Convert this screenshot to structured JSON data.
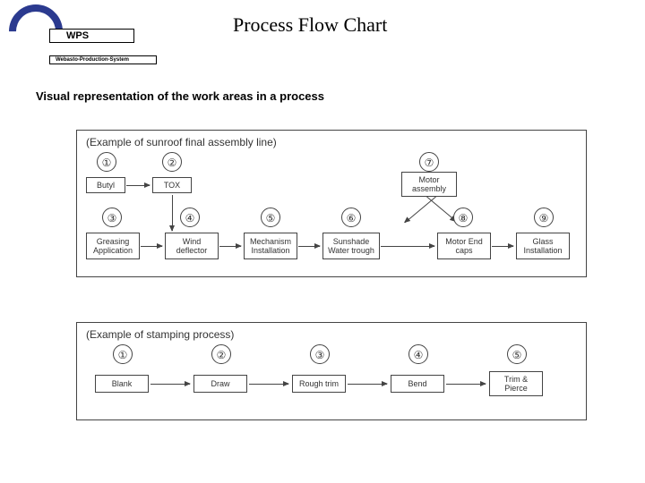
{
  "logo": {
    "abbr": "WPS",
    "full": "Webasto-Production-System"
  },
  "title": "Process Flow Chart",
  "subtitle": "Visual representation of the work areas in a process",
  "diagram1": {
    "caption": "(Example of sunroof final assembly line)",
    "steps": {
      "n1": "①",
      "n2": "②",
      "n3": "③",
      "n4": "④",
      "n5": "⑤",
      "n6": "⑥",
      "n7": "⑦",
      "n8": "⑧",
      "n9": "⑨"
    },
    "boxes": {
      "butyl": "Butyl",
      "tox": "TOX",
      "motor_assembly": "Motor assembly",
      "greasing": "Greasing Application",
      "wind": "Wind deflector",
      "mechanism": "Mechanism Installation",
      "sunshade": "Sunshade Water trough",
      "motor_endcaps": "Motor End caps",
      "glass": "Glass Installation"
    }
  },
  "diagram2": {
    "caption": "(Example of stamping process)",
    "steps": {
      "n1": "①",
      "n2": "②",
      "n3": "③",
      "n4": "④",
      "n5": "⑤"
    },
    "boxes": {
      "blank": "Blank",
      "draw": "Draw",
      "rough": "Rough trim",
      "bend": "Bend",
      "trim": "Trim & Pierce"
    }
  }
}
